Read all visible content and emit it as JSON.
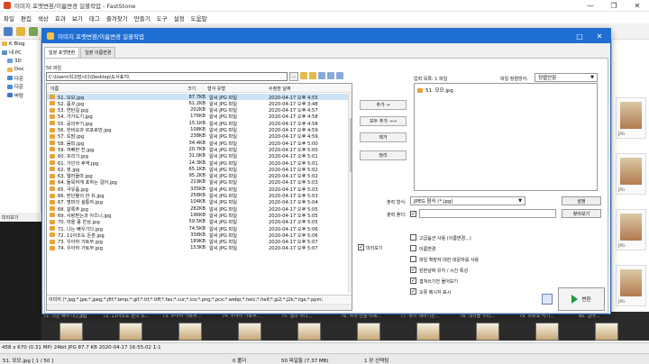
{
  "app": {
    "title": "이미지 포맷변환/이름변경 일괄작업  -  FastStone",
    "menu": [
      "파일",
      "편집",
      "색상",
      "효과",
      "보기",
      "태그",
      "즐겨찾기",
      "만들기",
      "도구",
      "설정",
      "도움말"
    ]
  },
  "tree": {
    "items": [
      "K Blog",
      "내 PC",
      "3D",
      "Doc",
      "다운",
      "다운",
      "바탕"
    ]
  },
  "preview_label": "미리보기",
  "dialog": {
    "title": "이미지 포맷변환/이름변경 일괄작업",
    "tabs": [
      "일괄 포맷변환",
      "일괄 이름변경"
    ],
    "file_count_label": "50 파일",
    "path": "C:\\Users\\위고맘시디\\Desktop\\도서표지\\",
    "path_browse": "...",
    "columns": [
      "이름",
      "크기",
      "형식 유형",
      "수정한 날짜"
    ],
    "files": [
      {
        "name": "51. 모모.jpg",
        "size": "87.7KB",
        "type": "알씨 JPG 파일",
        "date": "2020-04-17 오후 4:55"
      },
      {
        "name": "52. 품꾸.jpg",
        "size": "61.2KB",
        "type": "알씨 JPG 파일",
        "date": "2020-04-17 오후 3:48"
      },
      {
        "name": "53. 연탄길.jpg",
        "size": "202KB",
        "type": "알씨 JPG 파일",
        "date": "2020-04-17 오후 4:57"
      },
      {
        "name": "54. 가가도기.jpg",
        "size": "176KB",
        "type": "알씨 JPG 파일",
        "date": "2020-04-17 오후 4:58"
      },
      {
        "name": "55. 공의무기.jpg",
        "size": "15.1KB",
        "type": "알씨 JPG 파일",
        "date": "2020-04-17 오후 4:58"
      },
      {
        "name": "56. 한비요과 르포로먼.jpg",
        "size": "108KB",
        "type": "알씨 JPG 파일",
        "date": "2020-04-17 오후 4:59"
      },
      {
        "name": "57. 또맘.jpg",
        "size": "238KB",
        "type": "알씨 JPG 파일",
        "date": "2020-04-17 오후 4:59"
      },
      {
        "name": "58. 뭄피.jpg",
        "size": "34.4KB",
        "type": "알씨 JPG 파일",
        "date": "2020-04-17 오후 5:00"
      },
      {
        "name": "59. 꺼빠반 친.jpg",
        "size": "20.7KB",
        "type": "알씨 JPG 파일",
        "date": "2020-04-17 오후 5:00"
      },
      {
        "name": "60. 프리기.jpg",
        "size": "31.0KB",
        "type": "알씨 JPG 파일",
        "date": "2020-04-17 오후 5:01"
      },
      {
        "name": "61. 가인의 후역.jpg",
        "size": "14.3KB",
        "type": "알씨 JPG 파일",
        "date": "2020-04-17 오후 5:01"
      },
      {
        "name": "62. 핏.jpg",
        "size": "65.1KB",
        "type": "알씨 JPG 파일",
        "date": "2020-04-17 오후 5:02"
      },
      {
        "name": "63. 엘러들마.jpg",
        "size": "95.2KB",
        "type": "알씨 JPG 파일",
        "date": "2020-04-17 오후 5:02"
      },
      {
        "name": "64. 들목하게 포하는 걸어.jpg",
        "size": "219KB",
        "type": "알씨 JPG 파일",
        "date": "2020-04-17 오후 5:03"
      },
      {
        "name": "65. 극유품.jpg",
        "size": "335KB",
        "type": "알씨 JPG 파일",
        "date": "2020-04-17 오후 5:03"
      },
      {
        "name": "66. 맏단물의 한 유.jpg",
        "size": "258KB",
        "type": "알씨 JPG 파일",
        "date": "2020-04-17 오후 5:03"
      },
      {
        "name": "67. 멈머의 설통자.jpg",
        "size": "104KB",
        "type": "알씨 JPG 파일",
        "date": "2020-04-17 오후 5:04"
      },
      {
        "name": "68. 알록주.jpg",
        "size": "282KB",
        "type": "알씨 JPG 파일",
        "date": "2020-04-17 오후 5:05"
      },
      {
        "name": "69. 사랑받는과 아츠니.jpg",
        "size": "196KB",
        "type": "알씨 JPG 파일",
        "date": "2020-04-17 오후 5:05"
      },
      {
        "name": "70. 마을 풍 민상.jpg",
        "size": "59.5KB",
        "type": "알씨 JPG 파일",
        "date": "2020-04-17 오후 5:05"
      },
      {
        "name": "71. 나는 빠우기다.jpg",
        "size": "74.5KB",
        "type": "알씨 JPG 파일",
        "date": "2020-04-17 오후 5:06"
      },
      {
        "name": "72. 11아조도 돈훈.jpg",
        "size": "338KB",
        "type": "알씨 JPG 파일",
        "date": "2020-04-17 오후 5:06"
      },
      {
        "name": "73. 우아하 가토부.jpg",
        "size": "189KB",
        "type": "알씨 JPG 파일",
        "date": "2020-04-17 오후 5:07"
      },
      {
        "name": "74. 우아하 가토부.jpg",
        "size": "153KB",
        "type": "알씨 JPG 파일",
        "date": "2020-04-17 오후 5:07"
      }
    ],
    "filter_text": "이미지 (*.jpg;*.jpe;*.jpeg;*.jfif;*.bmp;*.gif;*.tif;*.tiff;*.fax;*.cur;*.ico;*.png;*.pcx;*.webp;*.heic;*.heif;*.jp2;*.j2k;*.tga;*.ppm;",
    "buttons": {
      "add": "추가  →",
      "add_all": "모두 추가  →→",
      "remove": "제거",
      "clear": "정리"
    },
    "preview_checkbox": "미리보기",
    "dest_count_label": "입력 목록:  1 파일",
    "sort_label": "파일 정렬방식:",
    "sort_value": "정렬안함",
    "dest_files": [
      "51. 모모.jpg"
    ],
    "output_format_label": "출력 형식:",
    "output_format_value": "JPEG 형식 (*.jpg)",
    "settings_btn": "설정",
    "output_folder_label": "출력 폴더:",
    "browse_btn": "찾아보기",
    "options": [
      {
        "label": "고급옵션 사용 (이름변경...)",
        "checked": false
      },
      {
        "label": "이름변경",
        "checked": false
      },
      {
        "label": "파일 확장자 대한 대문자를 사용",
        "checked": false
      },
      {
        "label": "원본날짜 유지 / 시간 특성",
        "checked": true
      },
      {
        "label": "겹쳐쓰기전 물어보기",
        "checked": true
      },
      {
        "label": "오류 메시지 표시",
        "checked": true
      }
    ],
    "convert_btn": "변환"
  },
  "thumbs_right": [
    "JPG",
    "JPG",
    "JPG",
    "JPG"
  ],
  "bottom_labels": [
    "71. 나는 빠우기다.jpg",
    "72. 11아조도 돈의 조...",
    "73. 우아하 가토부...",
    "74. 우아하 가토부...",
    "75. 엘라 하나...",
    "76. 하자 안녕 이제...",
    "77. 바지 세하기는...",
    "78. 대자들 우리...",
    "79. 마위요 딕기...",
    "80. 걸어..."
  ],
  "status": {
    "image_info": "458 x 670 (0.31 MP)  24bit  JPG  87.7 KB  2020-04-17 16:55:02  1:1",
    "file_name": "51. 모모.jpg [ 1 / 50 ]",
    "folders": "0 폴더",
    "files": "50 파일들 (7.37 MB)",
    "selected": "1 장 선택됨"
  }
}
